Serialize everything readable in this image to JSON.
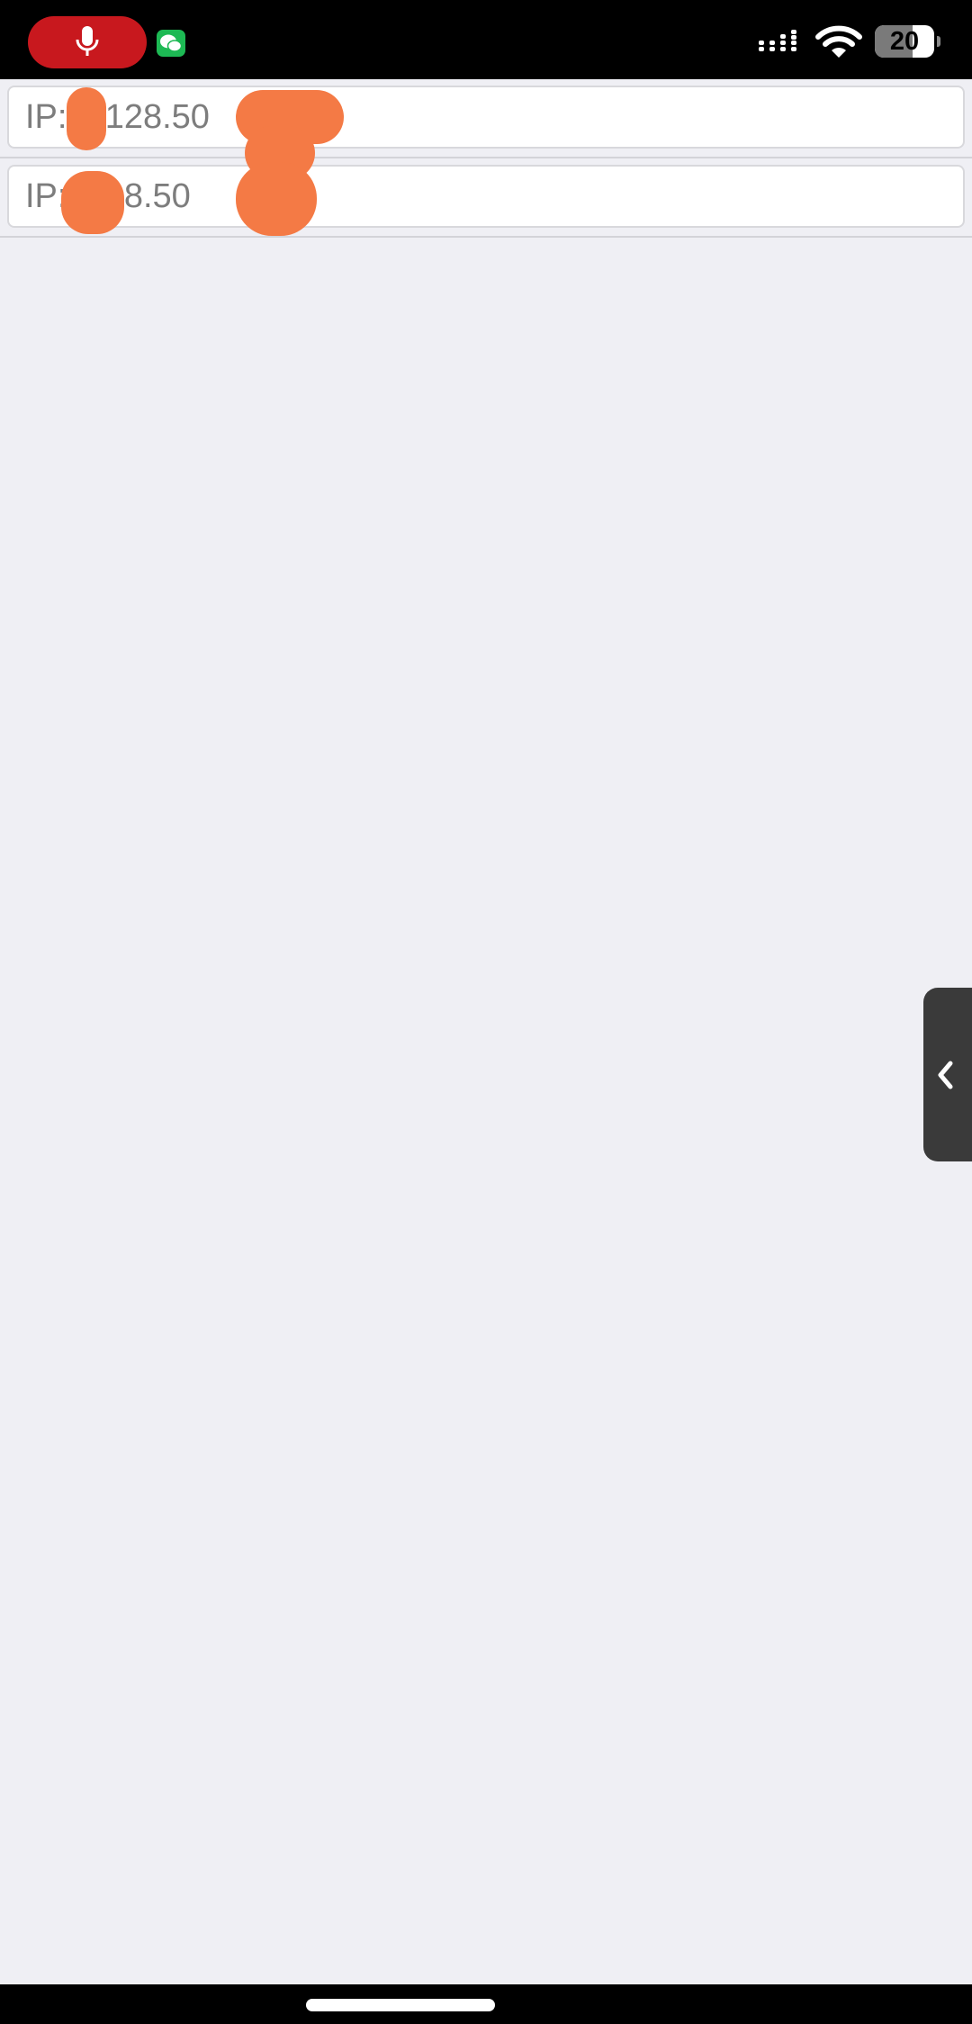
{
  "status_bar": {
    "battery_percent": "20",
    "battery_level": 0.2
  },
  "ip_list": [
    {
      "text": "IP:  9.128.50"
    },
    {
      "text": "IP:      .128.50"
    }
  ],
  "colors": {
    "background": "#EFEFF4",
    "mic_pill": "#C8181E",
    "redaction": "#F47A45",
    "side_handle": "#3A3A3A"
  }
}
